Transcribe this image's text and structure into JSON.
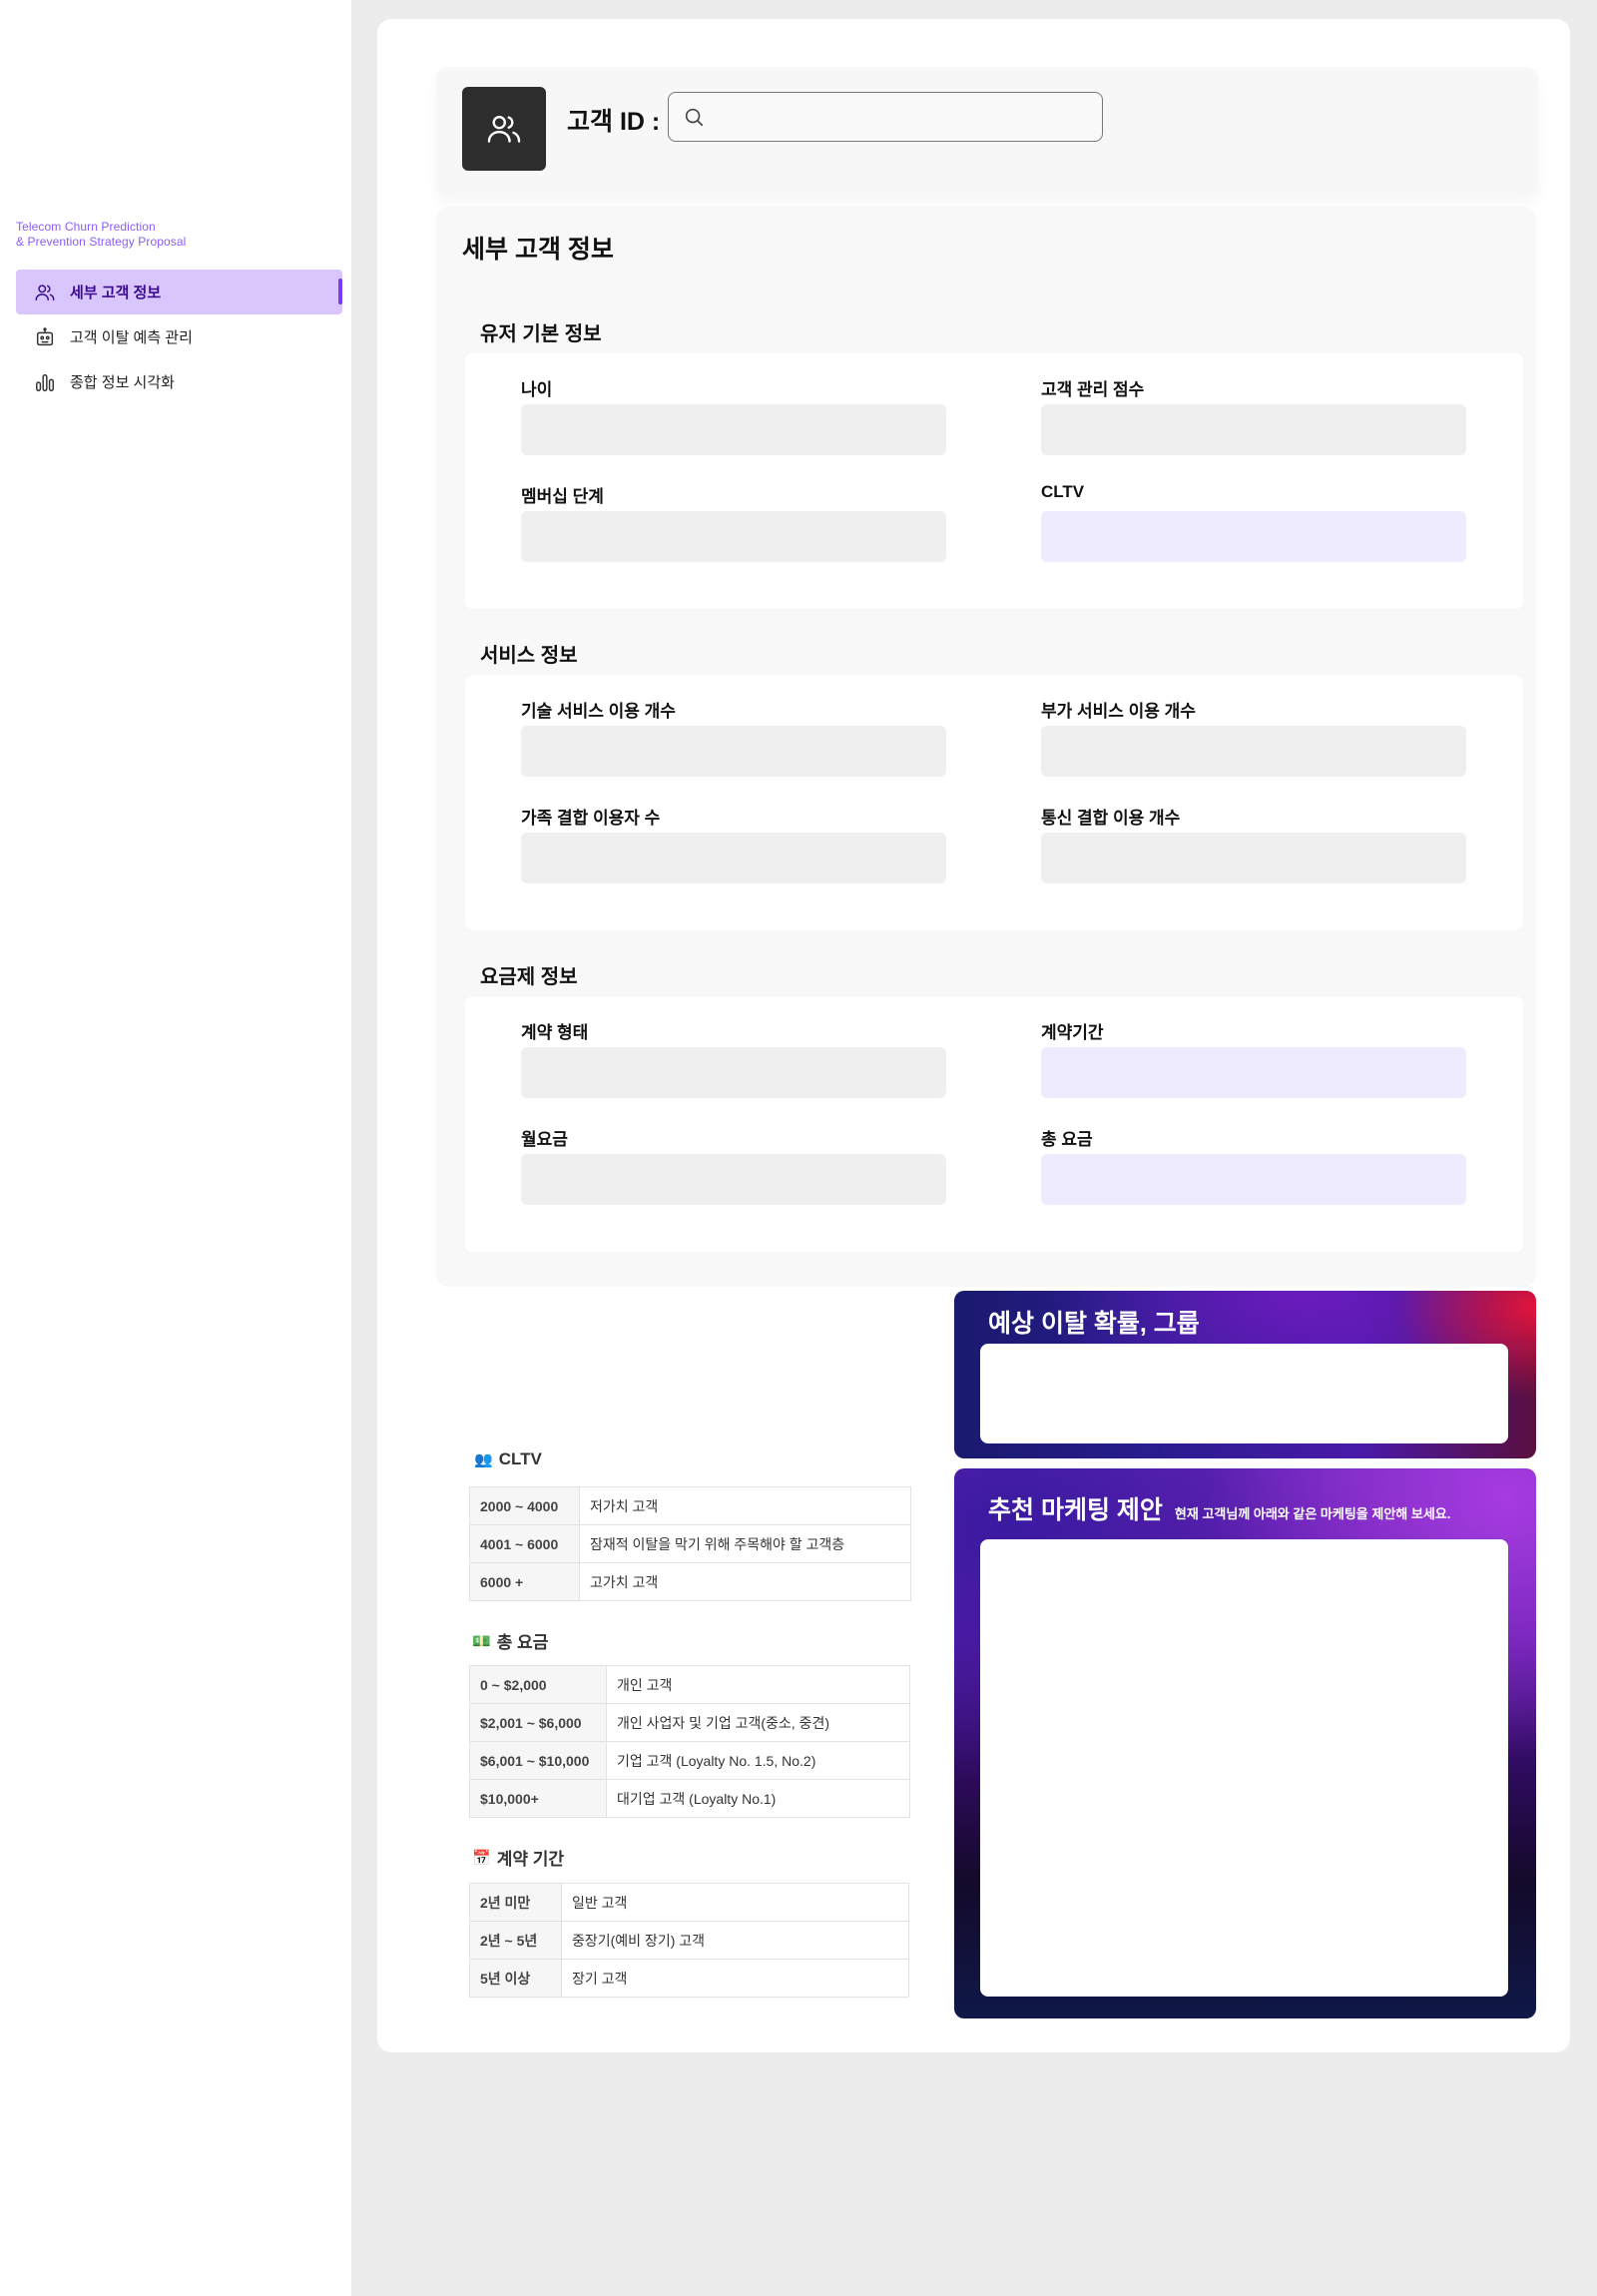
{
  "sidebar": {
    "brand_line1": "Telecom Churn Prediction",
    "brand_line2": "& Prevention Strategy Proposal",
    "items": [
      {
        "label": "세부 고객 정보",
        "icon": "users-icon",
        "active": true
      },
      {
        "label": "고객 이탈 예측 관리",
        "icon": "robot-icon",
        "active": false
      },
      {
        "label": "종합 정보 시각화",
        "icon": "bar-chart-icon",
        "active": false
      }
    ]
  },
  "search": {
    "label": "고객 ID :",
    "value": "",
    "placeholder": ""
  },
  "detail": {
    "title": "세부 고객 정보",
    "sections": [
      {
        "title": "유저 기본 정보",
        "fields": [
          {
            "label": "나이",
            "value": ""
          },
          {
            "label": "고객 관리 점수",
            "value": ""
          },
          {
            "label": "멤버십 단계",
            "value": ""
          },
          {
            "label": "CLTV",
            "value": ""
          }
        ]
      },
      {
        "title": "서비스 정보",
        "fields": [
          {
            "label": "기술 서비스 이용 개수",
            "value": ""
          },
          {
            "label": "부가 서비스 이용 개수",
            "value": ""
          },
          {
            "label": "가족 결합 이용자 수",
            "value": ""
          },
          {
            "label": "통신 결합 이용 개수",
            "value": ""
          }
        ]
      },
      {
        "title": "요금제 정보",
        "fields": [
          {
            "label": "계약 형태",
            "value": ""
          },
          {
            "label": "계약기간",
            "value": ""
          },
          {
            "label": "월요금",
            "value": ""
          },
          {
            "label": "총 요금",
            "value": ""
          }
        ]
      }
    ]
  },
  "tables": {
    "cltv": {
      "title": "CLTV",
      "emoji": "👥",
      "rows": [
        [
          "2000 ~ 4000",
          "저가치 고객"
        ],
        [
          "4001 ~ 6000",
          "잠재적 이탈을 막기 위해 주목해야 할 고객층"
        ],
        [
          "6000 +",
          "고가치 고객"
        ]
      ]
    },
    "total_fee": {
      "title": "총 요금",
      "emoji": "💵",
      "rows": [
        [
          "0 ~ $2,000",
          "개인 고객"
        ],
        [
          "$2,001 ~ $6,000",
          "개인 사업자 및 기업 고객(중소, 중견)"
        ],
        [
          "$6,001 ~ $10,000",
          "기업 고객 (Loyalty No. 1.5, No.2)"
        ],
        [
          "$10,000+",
          "대기업 고객 (Loyalty No.1)"
        ]
      ]
    },
    "contract": {
      "title": "계약 기간",
      "emoji": "📅",
      "rows": [
        [
          "2년 미만",
          "일반 고객"
        ],
        [
          "2년 ~ 5년",
          "중장기(예비 장기) 고객"
        ],
        [
          "5년 이상",
          "장기 고객"
        ]
      ]
    }
  },
  "prediction": {
    "title": "예상 이탈 확률, 그룹"
  },
  "marketing": {
    "title": "추천 마케팅 제안",
    "subtitle": "현재 고객님께 아래와 같은 마케팅을 제안해 보세요."
  },
  "colors": {
    "accent": "#7c3aed",
    "active_bg": "#d9c6fd",
    "lavender_field": "#efebff",
    "gray_field": "#efefef"
  }
}
